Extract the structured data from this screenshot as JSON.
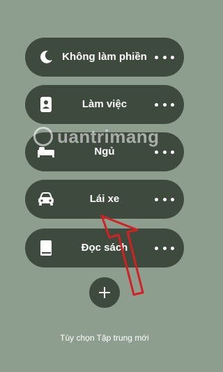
{
  "modes": [
    {
      "label": "Không làm phiền",
      "icon": "moon-icon"
    },
    {
      "label": "Làm việc",
      "icon": "id-badge-icon"
    },
    {
      "label": "Ngủ",
      "icon": "bed-icon"
    },
    {
      "label": "Lái xe",
      "icon": "car-icon"
    },
    {
      "label": "Đọc sách",
      "icon": "book-icon"
    }
  ],
  "new_focus": {
    "label": "Tùy chọn Tập trung mới",
    "icon": "plus-icon"
  },
  "watermark": {
    "text": "uantrimang"
  },
  "colors": {
    "background": "#8e9e8e",
    "pill": "#3f4a3f",
    "annotation": "#d32020"
  }
}
